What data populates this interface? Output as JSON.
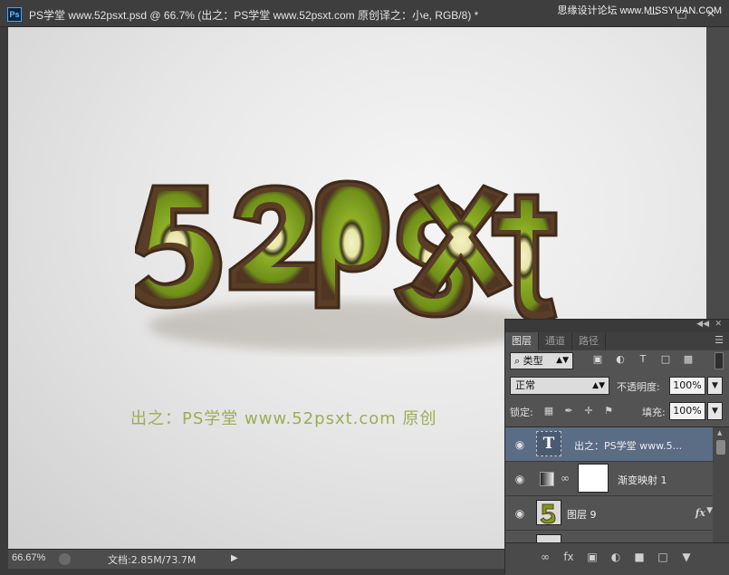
{
  "window": {
    "title": "PS学堂 www.52psxt.psd @ 66.7% (出之：PS学堂    www.52psxt.com      原创译之：小e, RGB/8) *",
    "watermark": "思缘设计论坛 www.MISSYUAN.COM",
    "logo_label": "Ps"
  },
  "canvas": {
    "artwork_text": "52psxt",
    "credit_text": "出之：PS学堂   www.52psxt.com       原创"
  },
  "status": {
    "zoom": "66.67%",
    "doc_info": "文档:2.85M/73.7M"
  },
  "layers_panel": {
    "tabs": [
      {
        "label": "图层",
        "active": true
      },
      {
        "label": "通道",
        "active": false
      },
      {
        "label": "路径",
        "active": false
      }
    ],
    "filter_kind": "类型",
    "blend_mode": "正常",
    "opacity_label": "不透明度:",
    "opacity_value": "100%",
    "lock_label": "锁定:",
    "fill_label": "填充:",
    "fill_value": "100%",
    "layers": [
      {
        "name": "出之：PS学堂    www.5...",
        "type": "text",
        "selected": true
      },
      {
        "name": "渐变映射 1",
        "type": "adjustment",
        "selected": false
      },
      {
        "name": "图层 9",
        "type": "pixel",
        "selected": false,
        "has_fx": true
      }
    ]
  },
  "colors": {
    "credit_green": "#9cad56",
    "selection_blue": "#5b6c85",
    "kiwi_flesh": "#7a9a1c",
    "kiwi_skin": "#6b4a2e"
  }
}
